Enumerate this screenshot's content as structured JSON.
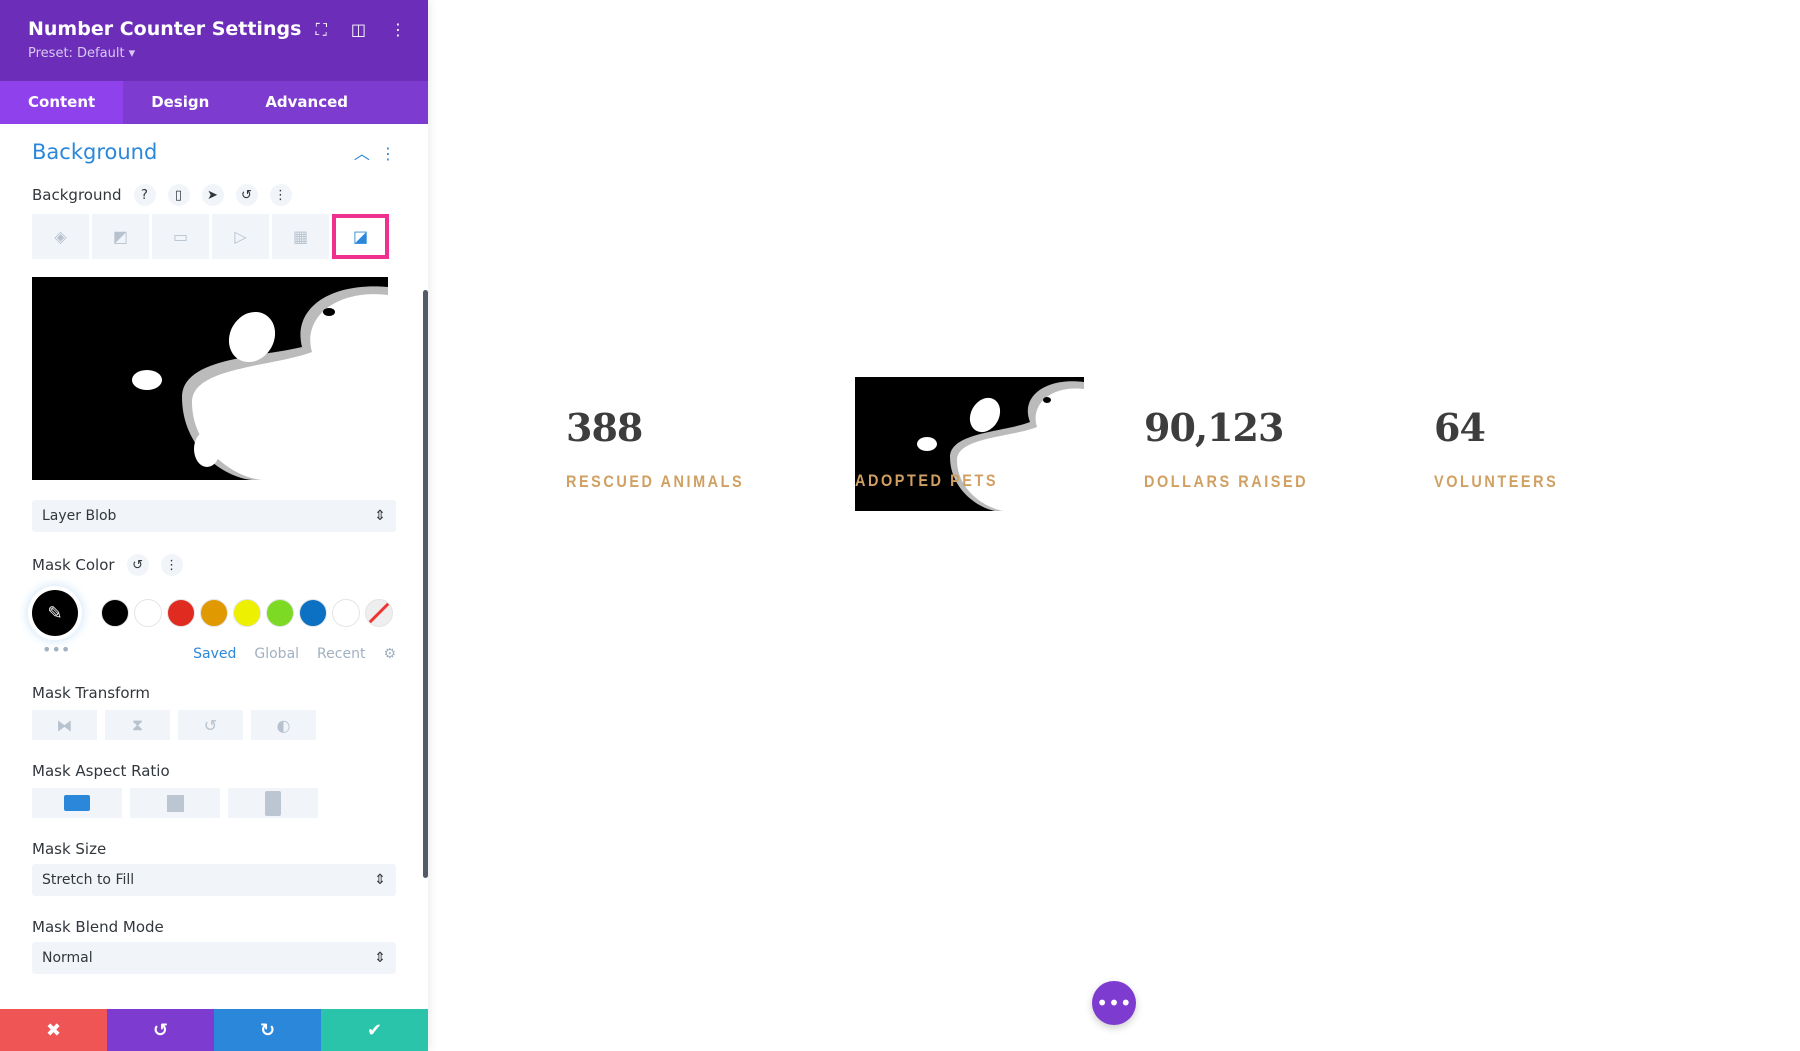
{
  "header": {
    "title": "Number Counter Settings",
    "preset": "Preset: Default ▾"
  },
  "tabs": [
    "Content",
    "Design",
    "Advanced"
  ],
  "section": {
    "title": "Background"
  },
  "background": {
    "label": "Background",
    "help": "?"
  },
  "mask": {
    "style": "Layer Blob",
    "color_label": "Mask Color",
    "palette": [
      "#000000",
      "#ffffff",
      "#e02b20",
      "#e09900",
      "#edf000",
      "#7cda24",
      "#0c71c3",
      "#ffffff"
    ],
    "palette_tabs": [
      "Saved",
      "Global",
      "Recent"
    ],
    "transform_label": "Mask Transform",
    "aspect_label": "Mask Aspect Ratio",
    "size_label": "Mask Size",
    "size_value": "Stretch to Fill",
    "blend_label": "Mask Blend Mode",
    "blend_value": "Normal"
  },
  "counters": [
    {
      "number": "388",
      "title": "RESCUED ANIMALS"
    },
    {
      "number": "",
      "title": "ADOPTED PETS"
    },
    {
      "number": "90,123",
      "title": "DOLLARS RAISED"
    },
    {
      "number": "64",
      "title": "VOLUNTEERS"
    }
  ],
  "colors": {
    "accent": "#2b87da",
    "header": "#6c2eb9",
    "label": "#d09f62"
  }
}
